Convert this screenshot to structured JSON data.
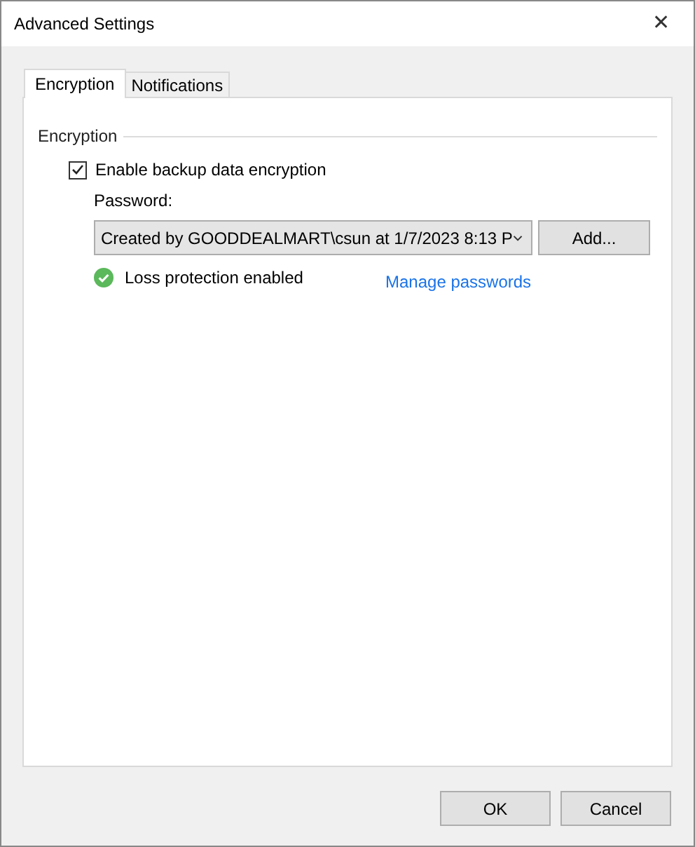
{
  "window": {
    "title": "Advanced Settings",
    "close": "✕"
  },
  "tabs": [
    {
      "label": "Encryption",
      "selected": true
    },
    {
      "label": "Notifications",
      "selected": false
    }
  ],
  "group": {
    "title": "Encryption"
  },
  "encryption": {
    "label": "Enable backup data encryption",
    "checked": true
  },
  "password": {
    "label": "Password:",
    "value": "Created by GOODDEALMART\\csun at 1/7/2023 8:13 P",
    "add_button": "Add..."
  },
  "status": {
    "text": "Loss protection enabled",
    "ok": true
  },
  "manage_link": "Manage passwords",
  "buttons": [
    "OK",
    "Cancel"
  ]
}
